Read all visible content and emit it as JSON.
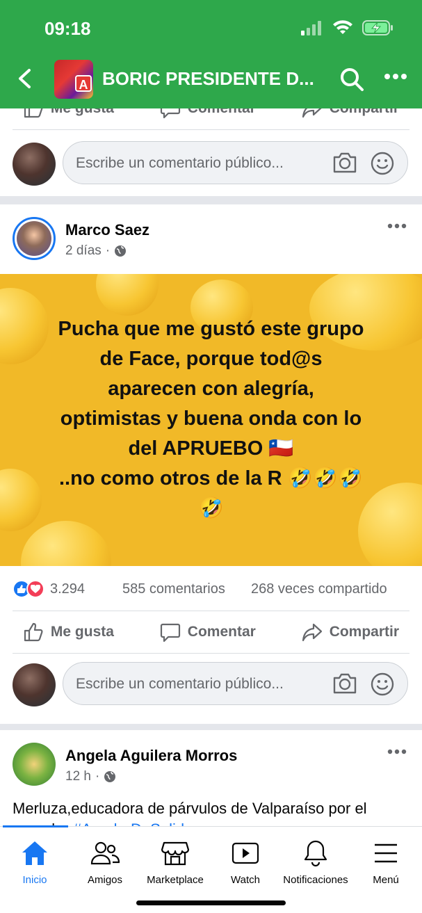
{
  "status_bar": {
    "time": "09:18"
  },
  "header": {
    "group_title": "BORIC PRESIDENTE D...",
    "group_avatar_text": "A",
    "icons": [
      "back-arrow-icon",
      "search-icon",
      "more-icon"
    ]
  },
  "prev_post": {
    "actions": {
      "like": "Me gusta",
      "comment": "Comentar",
      "share": "Compartir"
    },
    "comment_placeholder": "Escribe un comentario público..."
  },
  "post1": {
    "author": "Marco Saez",
    "time": "2 días",
    "separator": "·",
    "image_text_lines": [
      "Pucha que me gustó este grupo",
      "de Face, porque tod@s",
      "aparecen con alegría,",
      "optimistas y buena onda con lo",
      "del APRUEBO 🇨🇱",
      "..no como otros de la R 🤣🤣🤣",
      "🤣"
    ],
    "reactions": "3.294",
    "comments": "585 comentarios",
    "shares": "268 veces compartido",
    "actions": {
      "like": "Me gusta",
      "comment": "Comentar",
      "share": "Compartir"
    },
    "comment_placeholder": "Escribe un comentario público..."
  },
  "post2": {
    "author": "Angela Aguilera Morros",
    "time": "12 h",
    "separator": "·",
    "text": "Merluza,educadora de párvulos de Valparaíso por el",
    "text_line2": "apruebo ",
    "hashtag": "#AruebeDeSalida"
  },
  "tabbar": {
    "tabs": [
      {
        "label": "Inicio",
        "icon": "home-icon",
        "active": true
      },
      {
        "label": "Amigos",
        "icon": "friends-icon"
      },
      {
        "label": "Marketplace",
        "icon": "marketplace-icon"
      },
      {
        "label": "Watch",
        "icon": "watch-icon"
      },
      {
        "label": "Notificaciones",
        "icon": "bell-icon"
      },
      {
        "label": "Menú",
        "icon": "menu-icon"
      }
    ]
  },
  "colors": {
    "header_green": "#2ea84b",
    "facebook_blue": "#1877f2",
    "image_yellow": "#f1b928"
  }
}
